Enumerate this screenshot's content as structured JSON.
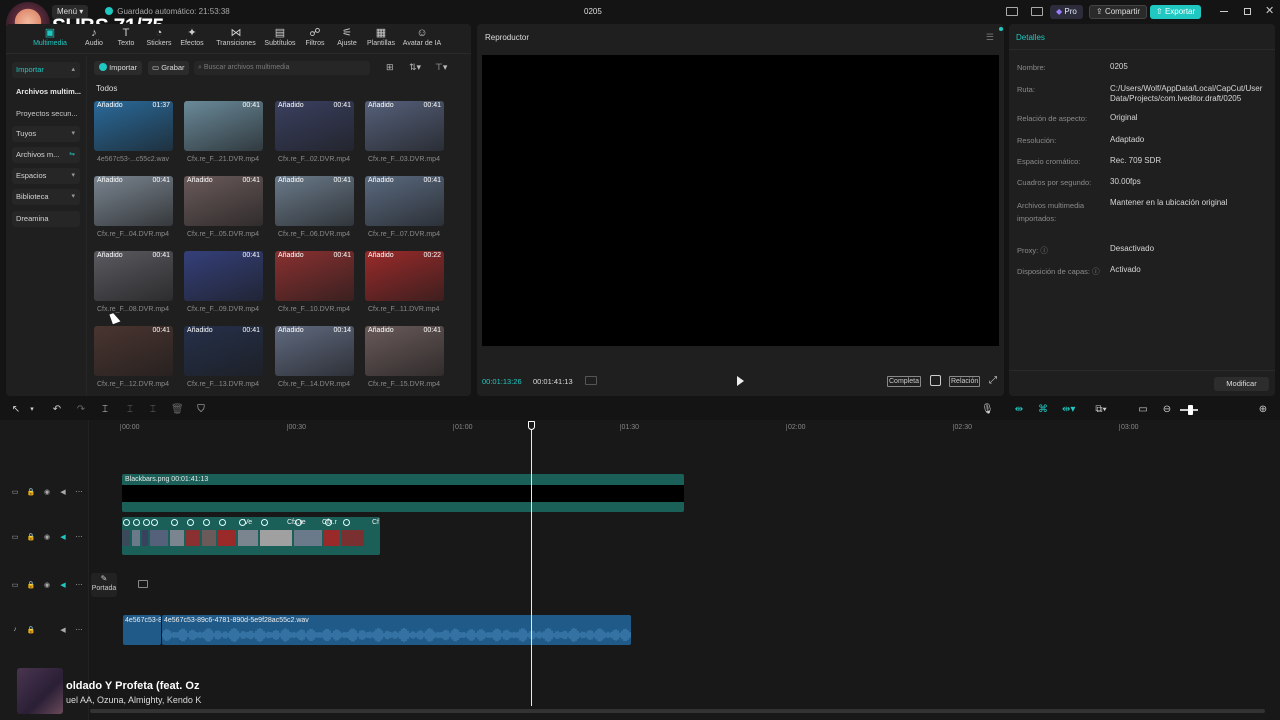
{
  "app": {
    "menu_label": "Menú",
    "autosave": "Guardado automático: 21:53:38",
    "project_title": "0205",
    "pro_label": "Pro",
    "share_label": "Compartir",
    "export_label": "Exportar",
    "subs_overlay": "SUBS 71/75",
    "colors": {
      "accent": "#1fc8c1",
      "panel": "#1f1f1f",
      "bg": "#141414",
      "video_clip": "#1a5f58",
      "audio_clip": "#1f5a88"
    }
  },
  "media_tabs": [
    {
      "label": "Multimedia",
      "icon": "media-icon"
    },
    {
      "label": "Audio",
      "icon": "audio-icon"
    },
    {
      "label": "Texto",
      "icon": "text-icon"
    },
    {
      "label": "Stickers",
      "icon": "sticker-icon"
    },
    {
      "label": "Efectos",
      "icon": "effects-icon"
    },
    {
      "label": "Transiciones",
      "icon": "transition-icon"
    },
    {
      "label": "Subtítulos",
      "icon": "subtitles-icon"
    },
    {
      "label": "Filtros",
      "icon": "filter-icon"
    },
    {
      "label": "Ajuste",
      "icon": "adjust-icon"
    },
    {
      "label": "Plantillas",
      "icon": "template-icon"
    },
    {
      "label": "Avatar de IA",
      "icon": "avatar-icon"
    }
  ],
  "sidebar": [
    {
      "label": "Importar"
    },
    {
      "label": "Archivos multim..."
    },
    {
      "label": "Proyectos secun..."
    },
    {
      "label": "Tuyos"
    },
    {
      "label": "Archivos m..."
    },
    {
      "label": "Espacios"
    },
    {
      "label": "Biblioteca"
    },
    {
      "label": "Dreamina"
    }
  ],
  "media_toolbar": {
    "import_label": "Importar",
    "record_label": "Grabar",
    "search_placeholder": "Buscar archivos multimedia",
    "all_label": "Todos"
  },
  "media_items": [
    {
      "name": "4e567c53-...c55c2.wav",
      "duration": "01:37",
      "tag": "Añadido",
      "color": "#2a6a9a"
    },
    {
      "name": "Cfx.re_F...21.DVR.mp4",
      "duration": "00:41",
      "tag": "",
      "color": "#6a8a9a"
    },
    {
      "name": "Cfx.re_F...02.DVR.mp4",
      "duration": "00:41",
      "tag": "Añadido",
      "color": "#3a4060"
    },
    {
      "name": "Cfx.re_F...03.DVR.mp4",
      "duration": "00:41",
      "tag": "Añadido",
      "color": "#55607a"
    },
    {
      "name": "Cfx.re_F...04.DVR.mp4",
      "duration": "00:41",
      "tag": "Añadido",
      "color": "#7a8590"
    },
    {
      "name": "Cfx.re_F...05.DVR.mp4",
      "duration": "00:41",
      "tag": "Añadido",
      "color": "#6a5a5a"
    },
    {
      "name": "Cfx.re_F...06.DVR.mp4",
      "duration": "00:41",
      "tag": "Añadido",
      "color": "#6a7a8a"
    },
    {
      "name": "Cfx.re_F...07.DVR.mp4",
      "duration": "00:41",
      "tag": "Añadido",
      "color": "#5a6a80"
    },
    {
      "name": "Cfx.re_F...08.DVR.mp4",
      "duration": "00:41",
      "tag": "Añadido",
      "color": "#5a5a60"
    },
    {
      "name": "Cfx.re_F...09.DVR.mp4",
      "duration": "00:41",
      "tag": "",
      "color": "#34407a"
    },
    {
      "name": "Cfx.re_F...10.DVR.mp4",
      "duration": "00:41",
      "tag": "Añadido",
      "color": "#8a3030"
    },
    {
      "name": "Cfx.re_F...11.DVR.mp4",
      "duration": "00:22",
      "tag": "Añadido",
      "color": "#9a2a2a"
    },
    {
      "name": "Cfx.re_F...12.DVR.mp4",
      "duration": "00:41",
      "tag": "",
      "color": "#4a3530"
    },
    {
      "name": "Cfx.re_F...13.DVR.mp4",
      "duration": "00:41",
      "tag": "Añadido",
      "color": "#25304a"
    },
    {
      "name": "Cfx.re_F...14.DVR.mp4",
      "duration": "00:14",
      "tag": "Añadido",
      "color": "#606a80"
    },
    {
      "name": "Cfx.re_F...15.DVR.mp4",
      "duration": "00:41",
      "tag": "Añadido",
      "color": "#6a5a5a"
    }
  ],
  "player": {
    "title": "Reproductor",
    "current_time": "00:01:13:26",
    "total_time": "00:01:41:13",
    "full_label": "Completa",
    "ratio_label": "Relación"
  },
  "details": {
    "title": "Detalles",
    "rows": [
      {
        "key": "Nombre:",
        "value": "0205"
      },
      {
        "key": "Ruta:",
        "value": "C:/Users/Wolf/AppData/Local/CapCut/User Data/Projects/com.lveditor.draft/0205"
      },
      {
        "key": "Relación de aspecto:",
        "value": "Original"
      },
      {
        "key": "Resolución:",
        "value": "Adaptado"
      },
      {
        "key": "Espacio cromático:",
        "value": "Rec. 709 SDR"
      },
      {
        "key": "Cuadros por segundo:",
        "value": "30.00fps"
      },
      {
        "key": "Archivos multimedia importados:",
        "value": "Mantener en la ubicación original"
      },
      {
        "key": "Proxy:",
        "value": "Desactivado"
      },
      {
        "key": "Disposición de capas:",
        "value": "Activado"
      }
    ],
    "modify_label": "Modificar"
  },
  "timeline": {
    "ruler": [
      "00:00",
      "00:30",
      "01:00",
      "01:30",
      "02:00",
      "02:30",
      "03:00"
    ],
    "overlay_clip_label": "Blackbars.png  00:01:41:13",
    "cover_label": "Portada",
    "audio_clip_short": "4e567c53-8",
    "audio_clip_label": "4e567c53-89c6-4781-890d-5e9f28ac55c2.wav",
    "main_clip_labels": [
      "Ve",
      "Cfx.re",
      "Cfx.r",
      "Cf"
    ]
  },
  "now_playing": {
    "title": "oldado Y Profeta (feat. Oz",
    "artists": "uel AA, Ozuna, Almighty, Kendo K"
  }
}
